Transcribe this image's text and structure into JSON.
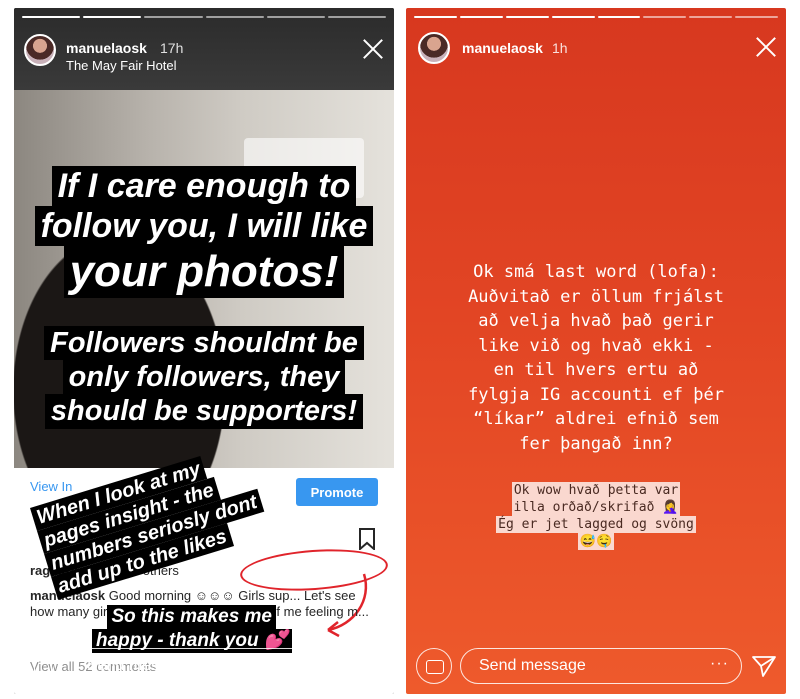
{
  "left_story": {
    "username": "manuelaosk",
    "time_ago": "17h",
    "location": "The May Fair Hotel",
    "overlay_lines": [
      "If I care enough to",
      "follow you, I will like",
      "your photos!",
      "Followers shouldnt be",
      "only followers, they",
      "should be supporters!"
    ],
    "rotated_lines": [
      "When I look at my",
      "pages insight - the",
      "numbers seriosly dont",
      "add up to the likes"
    ],
    "thanks_lines": [
      "So this makes me",
      "happy - thank you 💕"
    ],
    "post": {
      "view_insights": "View In",
      "promote_label": "Promote",
      "liked_by_name": "ragnars",
      "liked_by_rest": " and 1.089 others",
      "caption_user": "manuelaosk",
      "caption_text": "Good morning ☺☺☺ Girls sup... Let's see how many girls vs guys like these photos of me feeling m...",
      "view_all": "View all 52 comments"
    },
    "send_message_placeholder": "Send message"
  },
  "right_story": {
    "username": "manuelaosk",
    "time_ago": "1h",
    "main_text_lines": [
      "Ok smá last word (lofa):",
      "Auðvitað er öllum frjálst",
      "að velja hvað það gerir",
      "like við og hvað ekki -",
      "en til hvers ertu að",
      "fylgja IG accounti ef þér",
      "“líkar” aldrei efnið sem",
      "fer þangað inn?"
    ],
    "small_text_lines": [
      "Ok wow hvað þetta var",
      "illa orðað/skrifað 🤦‍♀️",
      "Ég er jet lagged og svöng",
      "😅🤤"
    ],
    "send_message_placeholder": "Send message",
    "more_label": "···"
  },
  "colors": {
    "insta_blue": "#3897f0",
    "annotation_red": "#e0242b",
    "story_red": "#e24524"
  },
  "icons": [
    "camera-icon",
    "send-icon",
    "close-icon",
    "bookmark-icon",
    "more-icon"
  ]
}
